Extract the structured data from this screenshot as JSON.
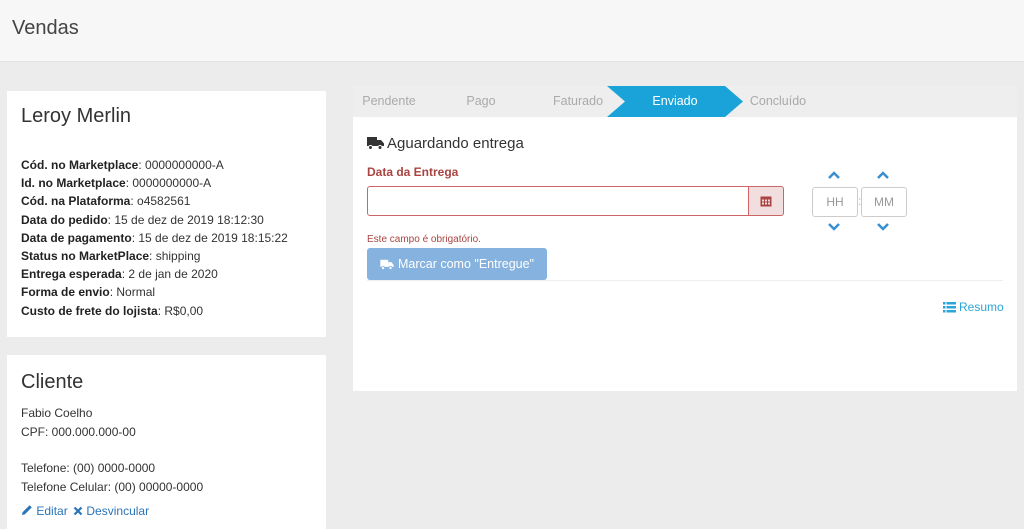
{
  "header": {
    "title": "Vendas"
  },
  "order": {
    "store_name": "Leroy Merlin",
    "fields": [
      {
        "label": "Cód. no Marketplace",
        "value": "0000000000-A"
      },
      {
        "label": "Id. no Marketplace",
        "value": "0000000000-A"
      },
      {
        "label": "Cód. na Plataforma",
        "value": "o4582561"
      },
      {
        "label": "Data do pedido",
        "value": "15 de dez de 2019 18:12:30"
      },
      {
        "label": "Data de pagamento",
        "value": "15 de dez de 2019 18:15:22"
      },
      {
        "label": "Status no MarketPlace",
        "value": "shipping"
      },
      {
        "label": "Entrega esperada",
        "value": "2 de jan de 2020"
      },
      {
        "label": "Forma de envio",
        "value": "Normal"
      },
      {
        "label": "Custo de frete do lojista",
        "value": "R$0,00"
      }
    ]
  },
  "client": {
    "title": "Cliente",
    "name": "Fabio Coelho",
    "cpf": "CPF: 000.000.000-00",
    "phone": "Telefone: (00) 0000-0000",
    "mobile": "Telefone Celular: (00) 00000-0000",
    "edit_label": "Editar",
    "unlink_label": "Desvincular"
  },
  "steps": [
    {
      "label": "Pendente",
      "active": false
    },
    {
      "label": "Pago",
      "active": false
    },
    {
      "label": "Faturado",
      "active": false
    },
    {
      "label": "Enviado",
      "active": true
    },
    {
      "label": "Concluído",
      "active": false
    }
  ],
  "delivery": {
    "status_title": "Aguardando entrega",
    "date_label": "Data da Entrega",
    "date_value": "",
    "hour_placeholder": "HH",
    "minute_placeholder": "MM",
    "time_separator": ":",
    "error_text": "Este campo é obrigatório.",
    "button_label": "Marcar como \"Entregue\"",
    "summary_link": "Resumo"
  },
  "colors": {
    "accent": "#1aa3d9",
    "error": "#a94442",
    "link": "#2a74b8",
    "button": "#85b2de"
  },
  "icons": {
    "status": "truck-icon",
    "calendar": "calendar-icon",
    "summary": "list-icon",
    "edit": "pencil-icon",
    "unlink": "times-icon"
  }
}
